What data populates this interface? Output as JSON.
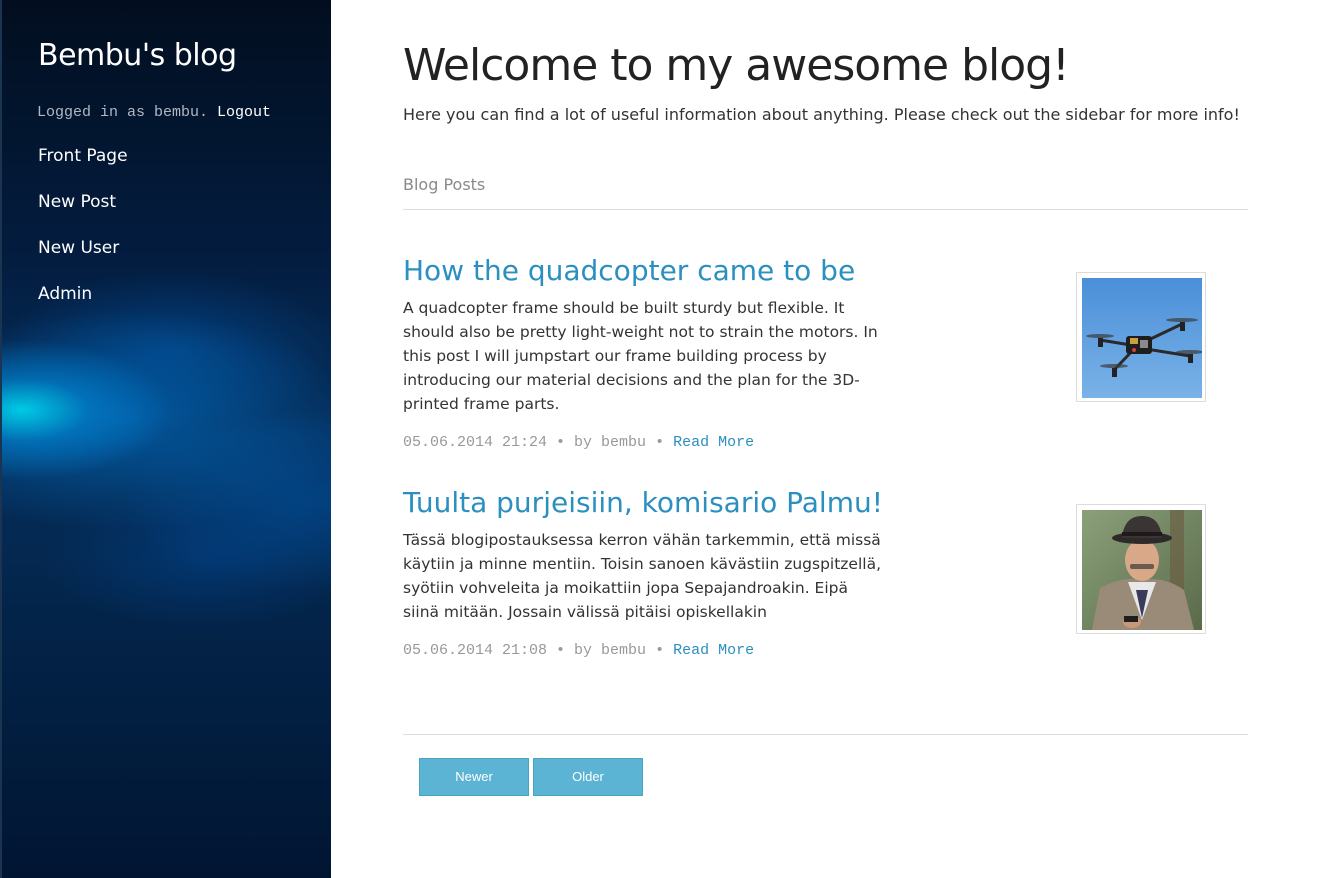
{
  "sidebar": {
    "blog_title": "Bembu's blog",
    "login_prefix": "Logged in as bembu.",
    "logout_label": "Logout",
    "nav": [
      {
        "label": "Front Page"
      },
      {
        "label": "New Post"
      },
      {
        "label": "New User"
      },
      {
        "label": "Admin"
      }
    ]
  },
  "main": {
    "title": "Welcome to my awesome blog!",
    "intro": "Here you can find a lot of useful information about anything. Please check out the sidebar for more info!",
    "section_label": "Blog Posts"
  },
  "posts": [
    {
      "title": "How the quadcopter came to be",
      "excerpt": "A quadcopter frame should be built sturdy but flexible. It should also be pretty light-weight not to strain the motors. In this post I will jumpstart our frame building process by introducing our material decisions and the plan for the 3D-printed frame parts.",
      "date": "05.06.2014 21:24",
      "by": "• by bembu •",
      "read_more": "Read More",
      "thumbnail_icon": "quadcopter-photo"
    },
    {
      "title": "Tuulta purjeisiin, komisario Palmu!",
      "excerpt": "Tässä blogipostauksessa kerron vähän tarkemmin, että missä käytiin ja minne mentiin. Toisin sanoen kävästiin zugspitzellä, syötiin vohveleita ja moikattiin jopa Sepajandroakin. Eipä siinä mitään. Jossain välissä pitäisi opiskellakin",
      "date": "05.06.2014 21:08",
      "by": "• by bembu •",
      "read_more": "Read More",
      "thumbnail_icon": "man-in-hat-photo"
    }
  ],
  "pager": {
    "newer_label": "Newer",
    "older_label": "Older"
  },
  "colors": {
    "accent": "#2b8fc0",
    "button": "#5bb4d3",
    "sidebar_dark": "#031d40"
  }
}
